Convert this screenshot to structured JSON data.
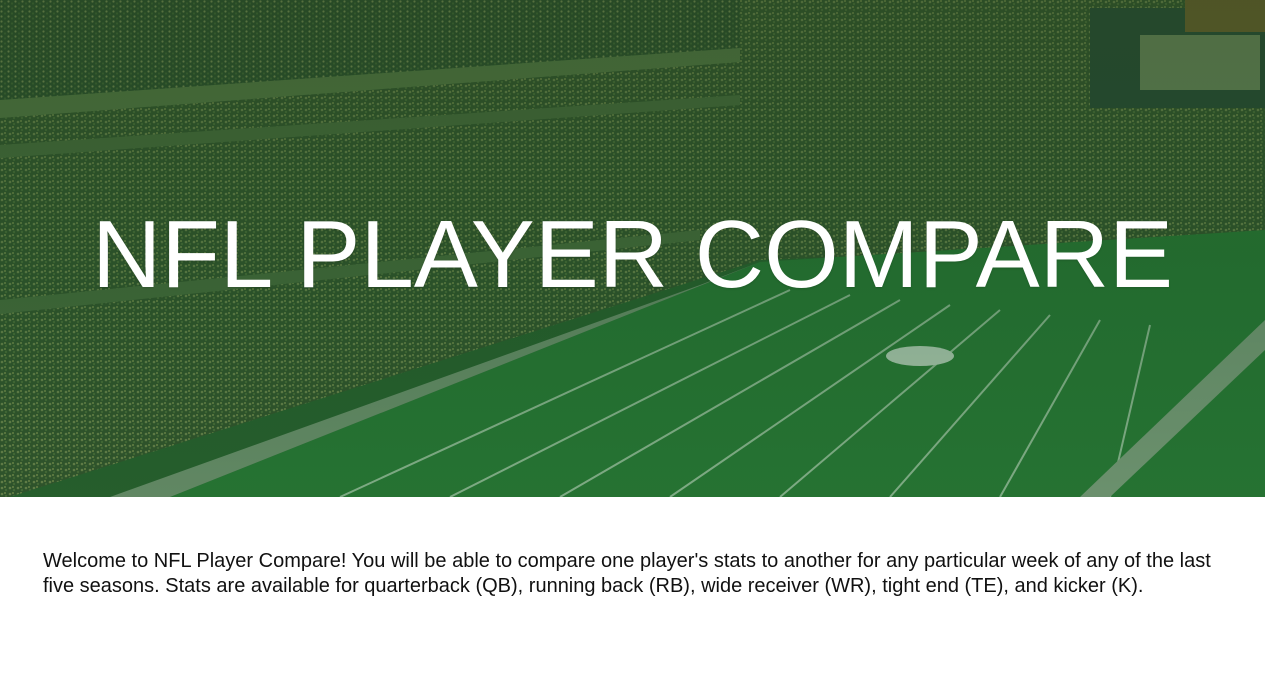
{
  "hero": {
    "title": "NFL PLAYER COMPARE",
    "background_image": "stadium-football-field-photo",
    "overlay_color": "#1e5a28"
  },
  "intro": {
    "text": "Welcome to NFL Player Compare! You will be able to compare one player's stats to another for any particular week of any of the last five seasons. Stats are available for quarterback (QB), running back (RB), wide receiver (WR), tight end (TE), and kicker (K)."
  }
}
